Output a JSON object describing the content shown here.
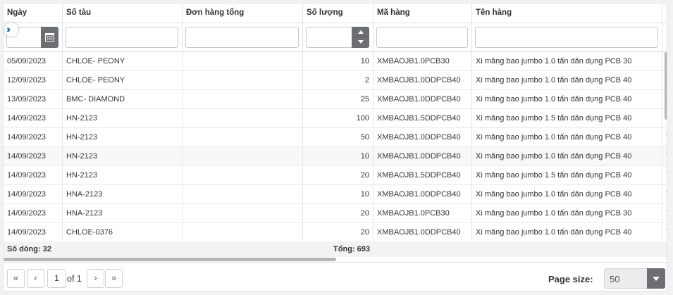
{
  "columns": [
    "Ngày",
    "Số tàu",
    "Đơn hàng tổng",
    "Số lượng",
    "Mã hàng",
    "Tên hàng"
  ],
  "rows": [
    {
      "ngay": "05/09/2023",
      "so_tau": "CHLOE- PEONY",
      "don_hang_tong": "",
      "so_luong": "10",
      "ma_hang": "XMBAOJB1.0PCB30",
      "ten_hang": "Xi măng bao jumbo 1.0 tấn dân dụng PCB 30",
      "extra": "T"
    },
    {
      "ngay": "12/09/2023",
      "so_tau": "CHLOE- PEONY",
      "don_hang_tong": "",
      "so_luong": "2",
      "ma_hang": "XMBAOJB1.0DDPCB40",
      "ten_hang": "Xi măng bao jumbo 1.0 tấn dân dụng PCB 40",
      "extra": "T"
    },
    {
      "ngay": "13/09/2023",
      "so_tau": "BMC- DIAMOND",
      "don_hang_tong": "",
      "so_luong": "25",
      "ma_hang": "XMBAOJB1.0DDPCB40",
      "ten_hang": "Xi măng bao jumbo 1.0 tấn dân dụng PCB 40",
      "extra": "T"
    },
    {
      "ngay": "14/09/2023",
      "so_tau": "HN-2123",
      "don_hang_tong": "",
      "so_luong": "100",
      "ma_hang": "XMBAOJB1.5DDPCB40",
      "ten_hang": "Xi măng bao jumbo 1.5 tấn dân dụng PCB 40",
      "extra": "T"
    },
    {
      "ngay": "14/09/2023",
      "so_tau": "HN-2123",
      "don_hang_tong": "",
      "so_luong": "50",
      "ma_hang": "XMBAOJB1.0DDPCB40",
      "ten_hang": "Xi măng bao jumbo 1.0 tấn dân dụng PCB 40",
      "extra": "T"
    },
    {
      "ngay": "14/09/2023",
      "so_tau": "HN-2123",
      "don_hang_tong": "",
      "so_luong": "10",
      "ma_hang": "XMBAOJB1.0DDPCB40",
      "ten_hang": "Xi măng bao jumbo 1.0 tấn dân dụng PCB 40",
      "extra": "T"
    },
    {
      "ngay": "14/09/2023",
      "so_tau": "HN-2123",
      "don_hang_tong": "",
      "so_luong": "20",
      "ma_hang": "XMBAOJB1.5DDPCB40",
      "ten_hang": "Xi măng bao jumbo 1.5 tấn dân dụng PCB 40",
      "extra": "T"
    },
    {
      "ngay": "14/09/2023",
      "so_tau": "HNA-2123",
      "don_hang_tong": "",
      "so_luong": "10",
      "ma_hang": "XMBAOJB1.0DDPCB40",
      "ten_hang": "Xi măng bao jumbo 1.0 tấn dân dụng PCB 40",
      "extra": "T"
    },
    {
      "ngay": "14/09/2023",
      "so_tau": "HNA-2123",
      "don_hang_tong": "",
      "so_luong": "20",
      "ma_hang": "XMBAOJB1.0PCB30",
      "ten_hang": "Xi măng bao jumbo 1.0 tấn dân dụng PCB 30",
      "extra": "T"
    },
    {
      "ngay": "14/09/2023",
      "so_tau": "CHLOE-0376",
      "don_hang_tong": "",
      "so_luong": "20",
      "ma_hang": "XMBAOJB1.0DDPCB40",
      "ten_hang": "Xi măng bao jumbo 1.0 tấn dân dụng PCB 40",
      "extra": "T"
    }
  ],
  "summary": {
    "row_count": "Số dòng: 32",
    "total": "Tổng: 693"
  },
  "pager": {
    "first": "«",
    "prev": "‹",
    "page": "1",
    "of_text": "of 1",
    "next": "›",
    "last": "»",
    "page_size_label": "Page size:",
    "page_size_value": "50"
  },
  "icons": {
    "calendar": "calendar-icon",
    "expand": "double-chevron-right-icon",
    "spinner": "spinner-icon",
    "dropdown": "chevron-down-icon"
  },
  "colors": {
    "accent": "#1e74d8",
    "button_dark": "#6b6f73"
  }
}
